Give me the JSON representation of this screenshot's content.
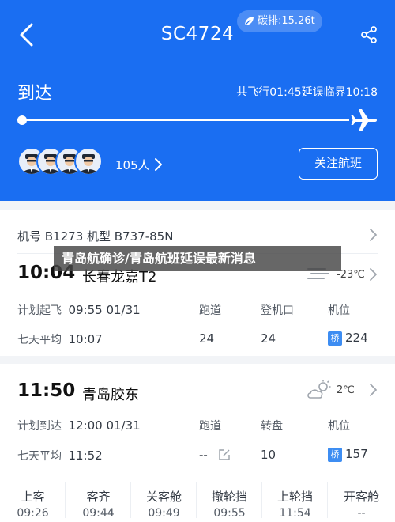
{
  "header": {
    "flight_no": "SC4724",
    "carbon_label": "碳排:15.26t",
    "status": "到达",
    "route_info": "共飞行01:45延误临界10:18",
    "passenger_count": "105人",
    "follow_button": "关注航班"
  },
  "aircraft": {
    "label": "机号 B1273   机型 B737-85N"
  },
  "departure": {
    "time": "10:04",
    "airport": "长春龙嘉T2",
    "temperature": "-23℃",
    "plan_label": "计划起飞",
    "plan_time": "09:55 01/31",
    "avg_label": "七天平均",
    "avg_time": "10:07",
    "col1_header": "跑道",
    "col1_value": "24",
    "col2_header": "登机口",
    "col2_value": "24",
    "col3_header": "机位",
    "badge": "桥",
    "col3_value": "224"
  },
  "arrival": {
    "time": "11:50",
    "airport": "青岛胶东",
    "temperature": "2℃",
    "plan_label": "计划到达",
    "plan_time": "12:00 01/31",
    "avg_label": "七天平均",
    "avg_time": "11:52",
    "col1_header": "跑道",
    "col1_value": "--",
    "col2_header": "转盘",
    "col2_value": "10",
    "col3_header": "机位",
    "badge": "桥",
    "col3_value": "157"
  },
  "timeline": [
    {
      "label": "上客",
      "time": "09:26"
    },
    {
      "label": "客齐",
      "time": "09:44"
    },
    {
      "label": "关客舱",
      "time": "09:49"
    },
    {
      "label": "撤轮挡",
      "time": "09:55"
    },
    {
      "label": "上轮挡",
      "time": "11:54"
    },
    {
      "label": "开客舱",
      "time": "--"
    }
  ],
  "overlay_banner": "青岛航确诊/青岛航班延误最新消息",
  "colors": {
    "brand": "#1a6ef2",
    "badge": "#3d8df2"
  }
}
